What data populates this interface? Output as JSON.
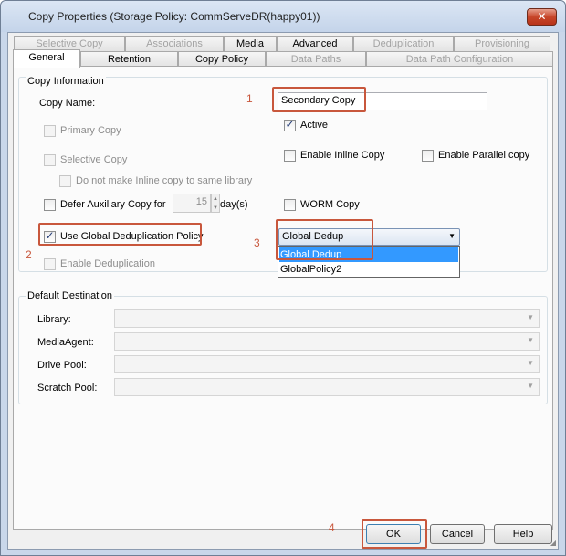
{
  "window": {
    "title": "Copy Properties (Storage Policy: CommServeDR(happy01))",
    "close_symbol": "✕"
  },
  "tabs": {
    "row1": [
      "Selective Copy",
      "Associations",
      "Media",
      "Advanced",
      "Deduplication",
      "Provisioning"
    ],
    "row2": [
      "General",
      "Retention",
      "Copy Policy",
      "Data Paths",
      "Data Path Configuration"
    ],
    "active": "General"
  },
  "copy_information": {
    "group_label": "Copy Information",
    "copy_name_label": "Copy Name:",
    "copy_name_value": "Secondary Copy",
    "active_label": "Active",
    "active_checked": true,
    "primary_copy_label": "Primary Copy",
    "selective_copy_label": "Selective Copy",
    "no_inline_label": "Do not make Inline copy to same library",
    "enable_inline_label": "Enable Inline Copy",
    "enable_parallel_label": "Enable Parallel copy",
    "defer_label": "Defer Auxiliary Copy for",
    "defer_value": "15",
    "defer_unit": "day(s)",
    "worm_label": "WORM Copy",
    "use_global_dedup_label": "Use Global Deduplication Policy",
    "use_global_dedup_checked": true,
    "enable_dedup_label": "Enable Deduplication",
    "dedup_policy_selected": "Global Dedup",
    "dedup_policy_options": [
      "Global Dedup",
      "GlobalPolicy2"
    ]
  },
  "default_destination": {
    "group_label": "Default Destination",
    "library_label": "Library:",
    "media_agent_label": "MediaAgent:",
    "drive_pool_label": "Drive Pool:",
    "scratch_pool_label": "Scratch Pool:"
  },
  "annotations": [
    "1",
    "2",
    "3",
    "4"
  ],
  "buttons": {
    "ok": "OK",
    "cancel": "Cancel",
    "help": "Help"
  },
  "colors": {
    "annotation": "#c8573c",
    "selection": "#3399ff"
  }
}
